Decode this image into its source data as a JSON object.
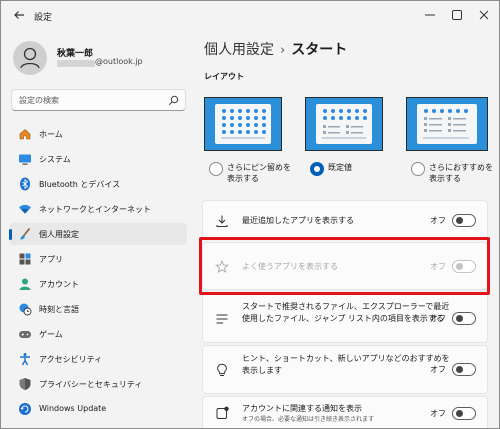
{
  "window": {
    "title": "設定"
  },
  "user": {
    "name": "秋葉一郎",
    "email": "@outlook.jp"
  },
  "search": {
    "placeholder": "設定の検索"
  },
  "nav": [
    {
      "label": "ホーム",
      "icon": "home-icon"
    },
    {
      "label": "システム",
      "icon": "system-icon"
    },
    {
      "label": "Bluetooth とデバイス",
      "icon": "bluetooth-icon"
    },
    {
      "label": "ネットワークとインターネット",
      "icon": "wifi-icon"
    },
    {
      "label": "個人用設定",
      "icon": "brush-icon",
      "active": true
    },
    {
      "label": "アプリ",
      "icon": "apps-icon"
    },
    {
      "label": "アカウント",
      "icon": "account-icon"
    },
    {
      "label": "時刻と言語",
      "icon": "clock-globe-icon"
    },
    {
      "label": "ゲーム",
      "icon": "gamepad-icon"
    },
    {
      "label": "アクセシビリティ",
      "icon": "accessibility-icon"
    },
    {
      "label": "プライバシーとセキュリティ",
      "icon": "shield-icon"
    },
    {
      "label": "Windows Update",
      "icon": "update-icon"
    }
  ],
  "breadcrumb": {
    "parent": "個人用設定",
    "separator": "›",
    "current": "スタート"
  },
  "layout": {
    "title": "レイアウト",
    "options": [
      {
        "label_line1": "さらにピン留めを",
        "label_line2": "表示する",
        "selected": false
      },
      {
        "label_line1": "既定値",
        "label_line2": "",
        "selected": true
      },
      {
        "label_line1": "さらにおすすめを",
        "label_line2": "表示する",
        "selected": false
      }
    ]
  },
  "settings": [
    {
      "label": "最近追加したアプリを表示する",
      "icon": "download-icon",
      "state": "オフ",
      "enabled": true
    },
    {
      "label": "よく使うアプリを表示する",
      "icon": "star-icon",
      "state": "オフ",
      "enabled": false
    },
    {
      "label_line1": "スタートで推奨されるファイル、エクスプローラーで最近",
      "label_line2": "使用したファイル、ジャンプ リスト内の項目を表示する",
      "icon": "list-icon",
      "state": "オフ",
      "enabled": true
    },
    {
      "label_line1": "ヒント、ショートカット、新しいアプリなどのおすすめを",
      "label_line2": "表示します",
      "icon": "lightbulb-icon",
      "state": "オフ",
      "enabled": true
    },
    {
      "label": "アカウントに関連する通知を表示",
      "sublabel": "オフの場合、必要な通知は引き続き表示されます",
      "icon": "account-notification-icon",
      "state": "オフ",
      "enabled": true
    }
  ],
  "colors": {
    "accent": "#005fb8",
    "highlight": "#e0141b",
    "layout_bg": "#2b8fd9"
  }
}
